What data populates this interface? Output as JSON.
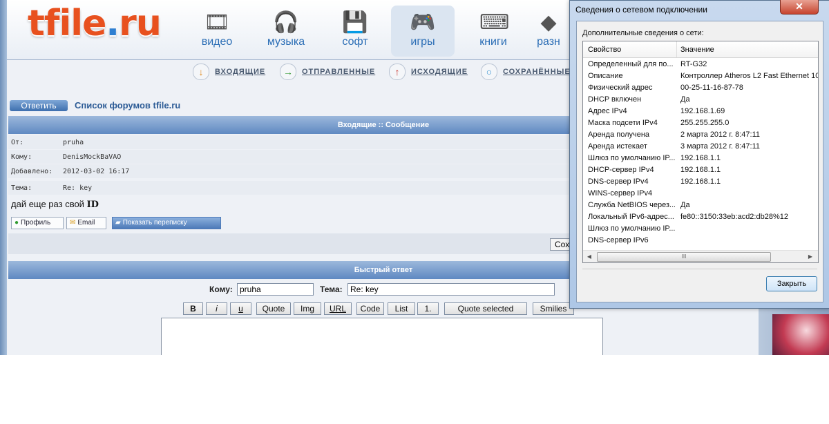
{
  "site": {
    "logo_main": "tfile",
    "logo_dot": ".",
    "logo_tld": "ru"
  },
  "nav": [
    {
      "label": "видео",
      "icon": "film-reel-icon",
      "glyph": "🎞"
    },
    {
      "label": "музыка",
      "icon": "headphones-icon",
      "glyph": "🎧"
    },
    {
      "label": "софт",
      "icon": "floppy-disk-icon",
      "glyph": "💾"
    },
    {
      "label": "игры",
      "icon": "gamepad-icon",
      "glyph": "🎮",
      "active": true
    },
    {
      "label": "книги",
      "icon": "typewriter-icon",
      "glyph": "⌨"
    },
    {
      "label": "разн",
      "icon": "box-icon",
      "glyph": "◆"
    }
  ],
  "mailbox": [
    {
      "label": "ВХОДЯЩИЕ",
      "icon": "inbox-arrow-icon",
      "glyph": "↓",
      "color": "#e08a1e"
    },
    {
      "label": "ОТПРАВЛЕННЫЕ",
      "icon": "sent-arrow-icon",
      "glyph": "→",
      "color": "#3a9c3a"
    },
    {
      "label": "ИСХОДЯЩИЕ",
      "icon": "outbox-arrow-icon",
      "glyph": "↑",
      "color": "#c8312a"
    },
    {
      "label": "СОХРАНЁННЫЕ",
      "icon": "saved-circle-icon",
      "glyph": "○",
      "color": "#2f8fd0"
    }
  ],
  "message": {
    "reply_button": "Ответить",
    "forum_link": "Список форумов tfile.ru",
    "header": "Входящие :: Сообщение",
    "fields": [
      {
        "k": "От:",
        "v": "pruha"
      },
      {
        "k": "Кому:",
        "v": "DenisMockBaVAO"
      },
      {
        "k": "Добавлено:",
        "v": "2012-03-02 16:17"
      },
      {
        "k": "Тема:",
        "v": "Re: key"
      }
    ],
    "body_text": "дай еще раз свой ",
    "body_bold": "ID",
    "profile_btn": "Профиль",
    "email_btn": "Email",
    "show_thread_btn": "Показать переписку",
    "save_btn": "Сох"
  },
  "quick_reply": {
    "header": "Быстрый ответ",
    "to_label": "Кому:",
    "to_value": "pruha",
    "subject_label": "Тема:",
    "subject_value": "Re: key",
    "toolbar": [
      "B",
      "i",
      "u",
      "Quote",
      "Img",
      "URL",
      "Code",
      "List",
      "1.",
      "Quote selected",
      "Smilies"
    ]
  },
  "dialog": {
    "title": "Сведения о сетевом подключении",
    "close_glyph": "✕",
    "subtitle": "Дополнительные сведения о сети:",
    "col_property": "Свойство",
    "col_value": "Значение",
    "rows": [
      {
        "p": "Определенный для по...",
        "v": "RT-G32"
      },
      {
        "p": "Описание",
        "v": "Контроллер Atheros L2 Fast Ethernet 10"
      },
      {
        "p": "Физический адрес",
        "v": "00-25-11-16-87-78"
      },
      {
        "p": "DHCP включен",
        "v": "Да"
      },
      {
        "p": "Адрес IPv4",
        "v": "192.168.1.69"
      },
      {
        "p": "Маска подсети IPv4",
        "v": "255.255.255.0"
      },
      {
        "p": "Аренда получена",
        "v": "2 марта 2012 г. 8:47:11"
      },
      {
        "p": "Аренда истекает",
        "v": "3 марта 2012 г. 8:47:11"
      },
      {
        "p": "Шлюз по умолчанию IP...",
        "v": "192.168.1.1"
      },
      {
        "p": "DHCP-сервер IPv4",
        "v": "192.168.1.1"
      },
      {
        "p": "DNS-сервер IPv4",
        "v": "192.168.1.1"
      },
      {
        "p": "WINS-сервер IPv4",
        "v": ""
      },
      {
        "p": "Служба NetBIOS через...",
        "v": "Да"
      },
      {
        "p": "Локальный IPv6-адрес...",
        "v": "fe80::3150:33eb:acd2:db28%12"
      },
      {
        "p": "Шлюз по умолчанию IP...",
        "v": ""
      },
      {
        "p": "DNS-сервер IPv6",
        "v": ""
      }
    ],
    "scroll_left": "◀",
    "scroll_right": "▶",
    "scroll_grip": "III",
    "close_button": "Закрыть"
  }
}
